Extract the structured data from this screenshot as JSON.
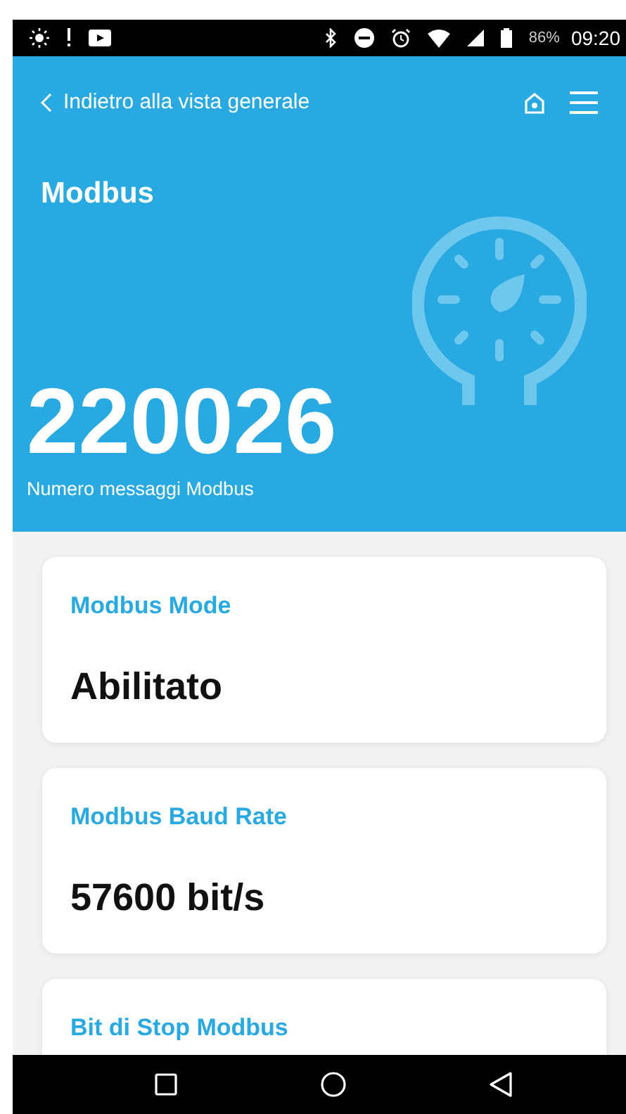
{
  "status_bar": {
    "battery": "86%",
    "time": "09:20"
  },
  "header": {
    "back_label": "Indietro alla vista generale",
    "title": "Modbus",
    "value": "220026",
    "value_label": "Numero messaggi Modbus"
  },
  "cards": [
    {
      "label": "Modbus Mode",
      "value": "Abilitato"
    },
    {
      "label": "Modbus Baud Rate",
      "value": "57600 bit/s"
    },
    {
      "label": "Bit di Stop Modbus"
    }
  ]
}
